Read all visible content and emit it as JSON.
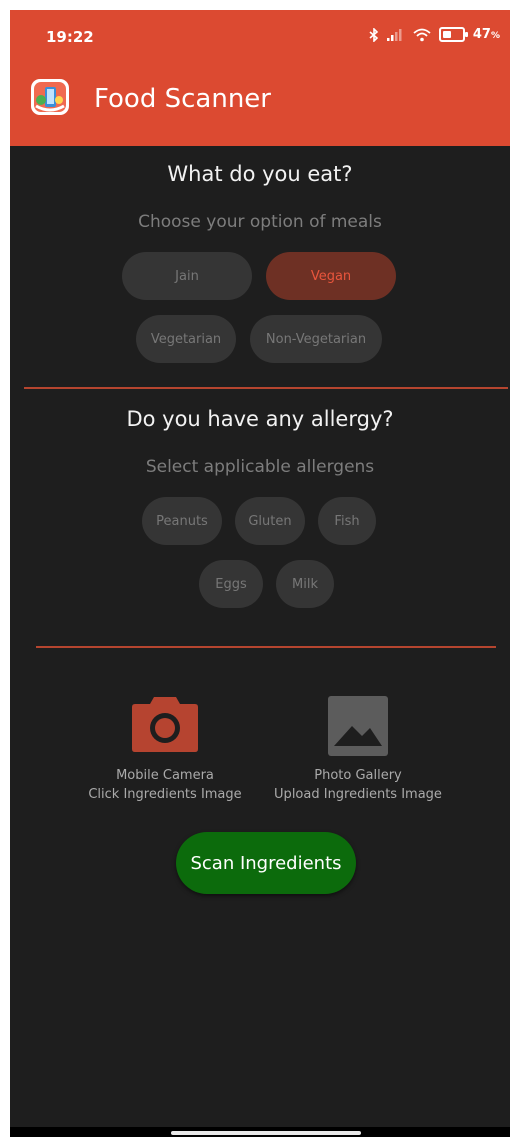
{
  "status_bar": {
    "time": "19:22",
    "battery": "47"
  },
  "app_bar": {
    "title": "Food Scanner",
    "icon": "food-scanner-app-icon"
  },
  "meals": {
    "title": "What do you eat?",
    "subtitle": "Choose your option of meals",
    "options": [
      "Jain",
      "Vegan",
      "Vegetarian",
      "Non-Vegetarian"
    ],
    "selected": "Vegan"
  },
  "allergy": {
    "title": "Do you have any allergy?",
    "subtitle": "Select applicable allergens",
    "options": [
      "Peanuts",
      "Gluten",
      "Fish",
      "Eggs",
      "Milk"
    ]
  },
  "sources": {
    "camera": {
      "title": "Mobile Camera",
      "subtitle": "Click Ingredients Image",
      "icon": "camera-icon"
    },
    "gallery": {
      "title": "Photo Gallery",
      "subtitle": "Upload Ingredients Image",
      "icon": "image-icon"
    }
  },
  "scan_button": {
    "label": "Scan Ingredients"
  },
  "colors": {
    "app_bar": "#dc4a31",
    "background": "#1e1e1e",
    "chip": "#353535",
    "chip_selected": "#6e3024",
    "accent": "#e8553c",
    "scan_button": "#0c6b0c"
  }
}
